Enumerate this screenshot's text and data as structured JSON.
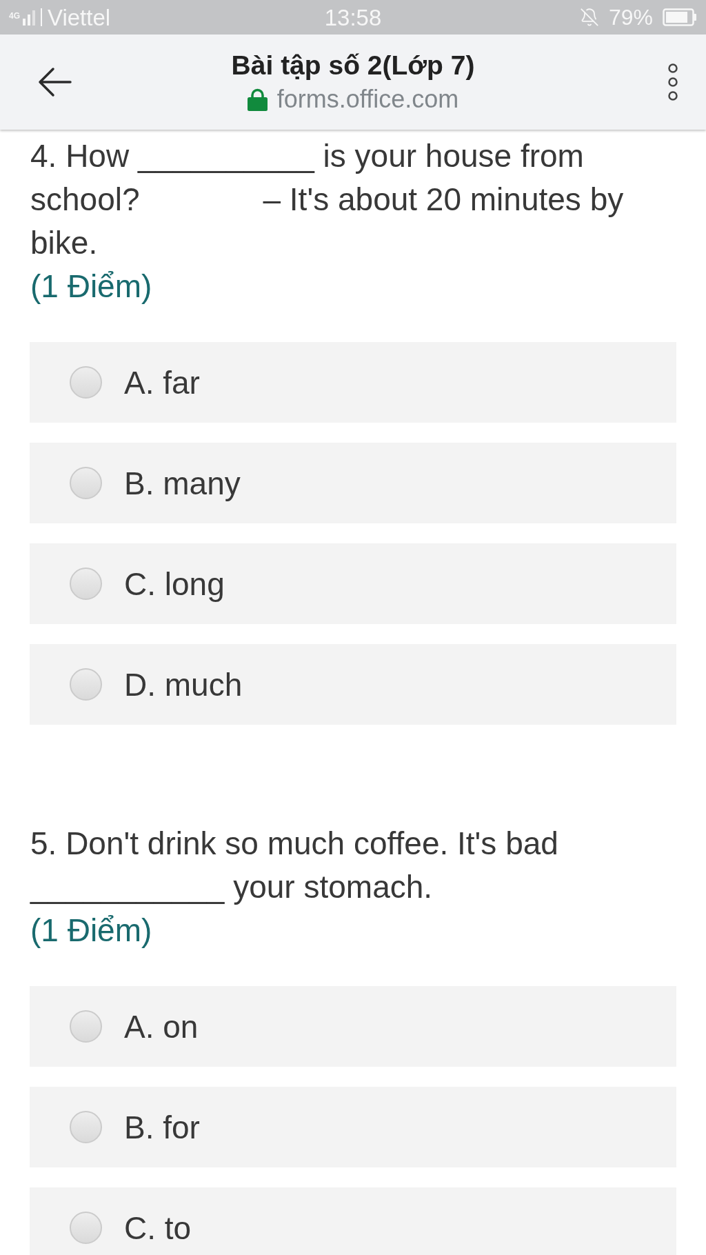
{
  "status_bar": {
    "network": "4G",
    "carrier": "Viettel",
    "time": "13:58",
    "battery": "79%"
  },
  "header": {
    "title": "Bài tập số 2(Lớp 7)",
    "url": "forms.office.com"
  },
  "questions": [
    {
      "text": "4. How __________ is your house from school?              – It's about 20 minutes by bike.",
      "points": "(1 Điểm)",
      "options": [
        {
          "label": "A. far",
          "selected": false
        },
        {
          "label": "B. many",
          "selected": false
        },
        {
          "label": "C. long",
          "selected": false
        },
        {
          "label": "D. much",
          "selected": false
        }
      ]
    },
    {
      "text": "5. Don't drink so much coffee. It's bad ___________ your stomach.",
      "points": "(1 Điểm)",
      "options": [
        {
          "label": "A. on",
          "selected": false
        },
        {
          "label": "B. for",
          "selected": false
        },
        {
          "label": "C. to",
          "selected": false
        }
      ]
    }
  ]
}
